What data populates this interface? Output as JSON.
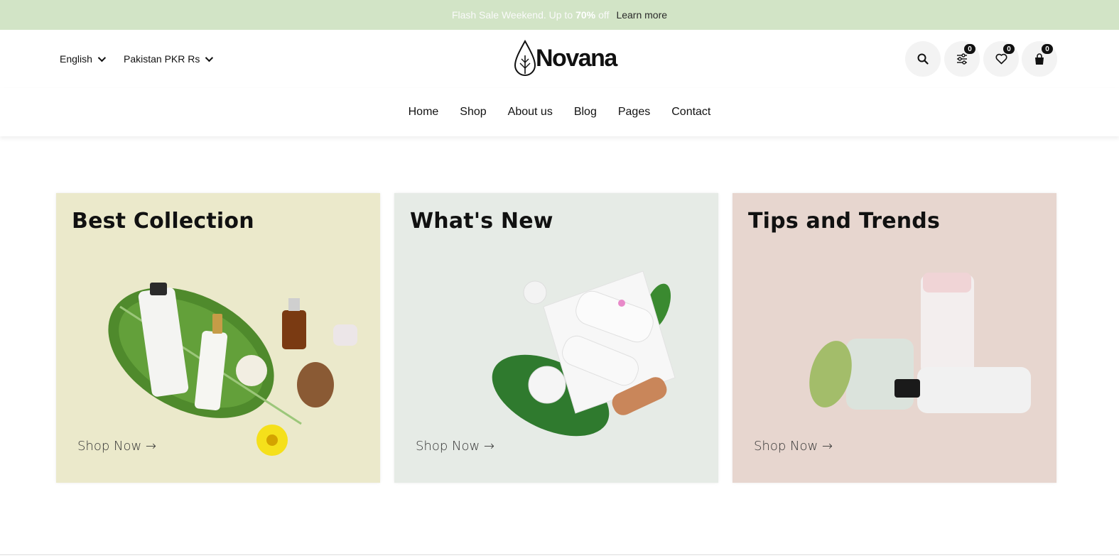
{
  "promo": {
    "text": "Flash Sale Weekend. Up to",
    "percent": "70%",
    "suffix": "off",
    "link": "Learn more"
  },
  "header": {
    "language": "English",
    "currency": "Pakistan PKR Rs",
    "logo_text": "Novana",
    "counts": {
      "compare": "0",
      "wishlist": "0",
      "cart": "0"
    }
  },
  "nav": {
    "items": [
      "Home",
      "Shop",
      "About us",
      "Blog",
      "Pages",
      "Contact"
    ]
  },
  "cards": [
    {
      "title": "Best Collection",
      "cta": "Shop Now →",
      "bg": "#ebe9cb"
    },
    {
      "title": "What's New",
      "cta": "Shop Now →",
      "bg": "#e6ebe6"
    },
    {
      "title": "Tips and Trends",
      "cta": "Shop Now →",
      "bg": "#e7d6cf"
    }
  ],
  "colors": {
    "promo_bg": "#d2e4c6",
    "icon_bg": "#f3f3f3",
    "badge_bg": "#111111"
  },
  "icons": [
    "search-icon",
    "filter-icon",
    "heart-icon",
    "shopping-bag-icon",
    "leaf-logo-icon",
    "chevron-down-icon"
  ]
}
